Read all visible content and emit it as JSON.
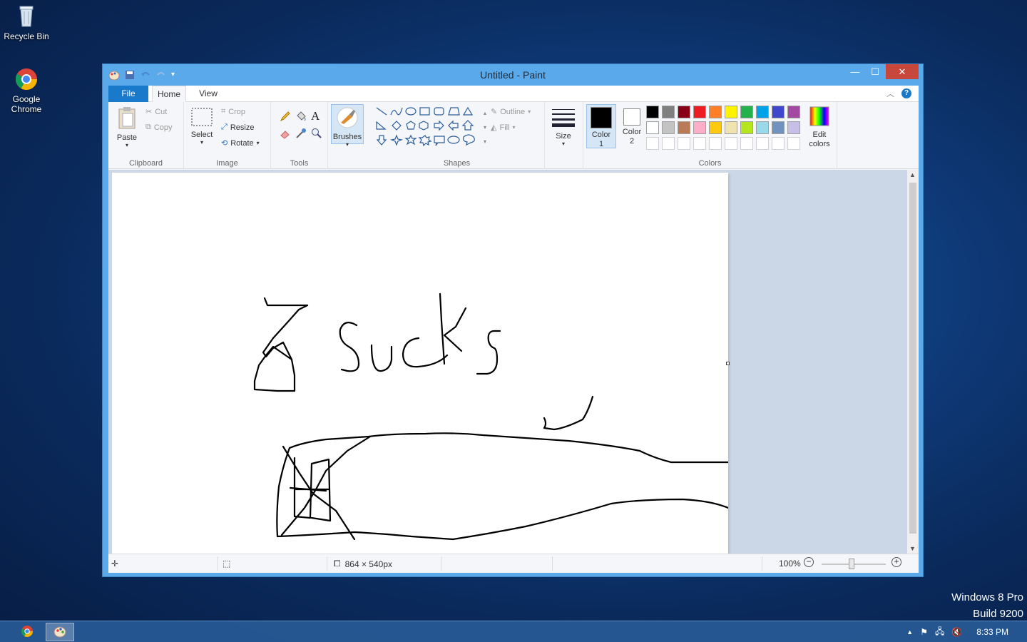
{
  "desktop": {
    "icons": [
      {
        "label": "Recycle Bin"
      },
      {
        "label": "Google\nChrome"
      }
    ],
    "watermark": {
      "line1": "Windows 8 Pro",
      "line2": "Build 9200"
    }
  },
  "window": {
    "title": "Untitled - Paint",
    "controls": {
      "minimize": "—",
      "maximize": "☐",
      "close": "✕"
    }
  },
  "ribbon": {
    "tabs": {
      "file": "File",
      "home": "Home",
      "view": "View"
    },
    "clipboard": {
      "label": "Clipboard",
      "paste": "Paste",
      "cut": "Cut",
      "copy": "Copy"
    },
    "image": {
      "label": "Image",
      "select": "Select",
      "crop": "Crop",
      "resize": "Resize",
      "rotate": "Rotate"
    },
    "tools": {
      "label": "Tools"
    },
    "brushes": {
      "label": "Brushes"
    },
    "shapes": {
      "label": "Shapes",
      "outline": "Outline",
      "fill": "Fill"
    },
    "size": {
      "label": "Size"
    },
    "colors": {
      "label": "Colors",
      "color1": "Color\n1",
      "color2": "Color\n2",
      "edit": "Edit\ncolors",
      "color1_value": "#000000",
      "color2_value": "#ffffff",
      "palette_row1": [
        "#000000",
        "#7f7f7f",
        "#880015",
        "#ed1c24",
        "#ff7f27",
        "#fff200",
        "#22b14c",
        "#00a2e8",
        "#3f48cc",
        "#a349a4"
      ],
      "palette_row2": [
        "#ffffff",
        "#c3c3c3",
        "#b97a57",
        "#ffaec9",
        "#ffc90e",
        "#efe4b0",
        "#b5e61d",
        "#99d9ea",
        "#7092be",
        "#c8bfe7"
      ]
    }
  },
  "statusbar": {
    "size": "864 × 540px",
    "zoom": "100%"
  },
  "taskbar": {
    "time": "8:33 PM"
  }
}
